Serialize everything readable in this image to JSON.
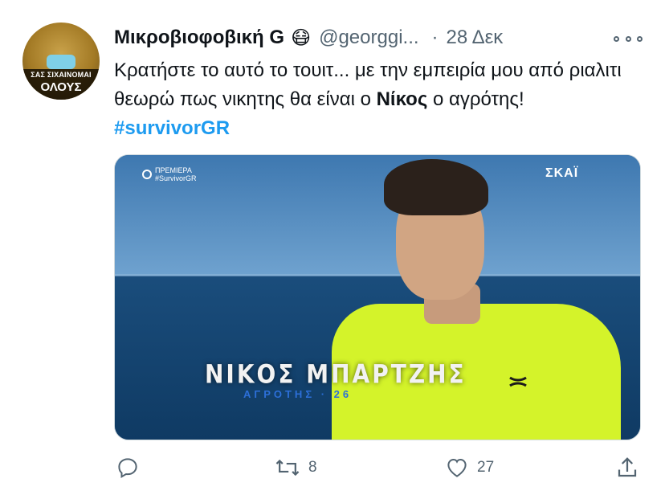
{
  "tweet": {
    "display_name": "Μικροβιοφοβική G",
    "emoji": "😷",
    "handle": "@georggi...",
    "dot": "·",
    "date": "28 Δεκ",
    "text_part1": "Κρατήστε το αυτό το τουιτ... με την εμπειρία μου από ριαλιτι θεωρώ πως νικητης θα είναι ο ",
    "text_bold": "Νίκος",
    "text_part2": " ο αγρότης! ",
    "hashtag": "#survivorGR"
  },
  "avatar": {
    "line1": "ΣΑΣ ΣΙΧΑΙΝΟΜΑΙ",
    "line2": "ΟΛΟΥΣ"
  },
  "media": {
    "premiere_label": "ΠΡΕΜΙΕΡΑ",
    "premiere_tag": "#SurvivorGR",
    "channel": "ΣΚΑΪ",
    "lower_third_name": "ΝΙΚΟΣ ΜΠΑΡΤΖΗΣ",
    "lower_third_sub": "ΑΓΡΟΤΗΣ · 26"
  },
  "actions": {
    "reply_icon": "reply-icon",
    "retweet_icon": "retweet-icon",
    "retweet_count": "8",
    "like_icon": "heart-icon",
    "like_count": "27",
    "share_icon": "share-icon"
  },
  "colors": {
    "link": "#1d9bf0",
    "secondary_text": "#536471",
    "primary_text": "#0f1419"
  }
}
